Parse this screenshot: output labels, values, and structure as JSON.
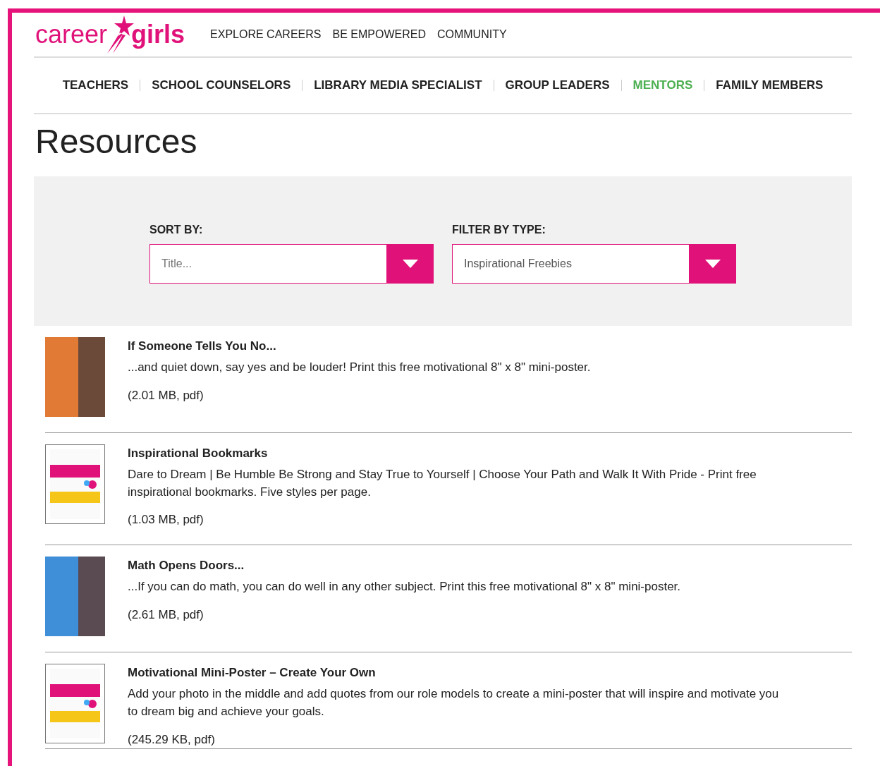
{
  "logo": {
    "part_1": "career",
    "part_2": "girls"
  },
  "main_nav": [
    {
      "label": "EXPLORE CAREERS"
    },
    {
      "label": "BE EMPOWERED"
    },
    {
      "label": "COMMUNITY"
    }
  ],
  "audience_nav": [
    {
      "label": "TEACHERS",
      "selected": false
    },
    {
      "label": "SCHOOL COUNSELORS",
      "selected": false
    },
    {
      "label": "LIBRARY MEDIA SPECIALIST",
      "selected": false
    },
    {
      "label": "GROUP LEADERS",
      "selected": false
    },
    {
      "label": "MENTORS",
      "selected": true
    },
    {
      "label": "FAMILY MEMBERS",
      "selected": false
    }
  ],
  "page_title": "Resources",
  "filters": [
    {
      "label": "SORT BY:",
      "placeholder": "Title..."
    },
    {
      "label": "FILTER BY TYPE:",
      "value": "Inspirational Freebies"
    }
  ],
  "resources": [
    {
      "title": "If Someone Tells You No...",
      "description": "...and quiet down, say yes and be louder! Print this free motivational 8\" x 8\" mini-poster.",
      "file_info": "(2.01 MB, pdf)",
      "kind": "photo"
    },
    {
      "title": "Inspirational Bookmarks",
      "description": "Dare to Dream | Be Humble Be Strong and Stay True to Yourself | Choose Your Path and Walk It With Pride - Print free inspirational bookmarks. Five styles per page.",
      "file_info": "(1.03 MB, pdf)",
      "kind": "document"
    },
    {
      "title": "Math Opens Doors...",
      "description": "...If you can do math, you can do well in any other subject. Print this free motivational 8\" x 8\" mini-poster.",
      "file_info": "(2.61 MB, pdf)",
      "kind": "photo"
    },
    {
      "title": "Motivational Mini-Poster – Create Your Own",
      "description": "Add your photo in the middle and add quotes from our role models to create a mini-poster that will inspire and motivate you to dream big and achieve your goals.",
      "file_info": "(245.29 KB, pdf)",
      "kind": "document"
    }
  ]
}
